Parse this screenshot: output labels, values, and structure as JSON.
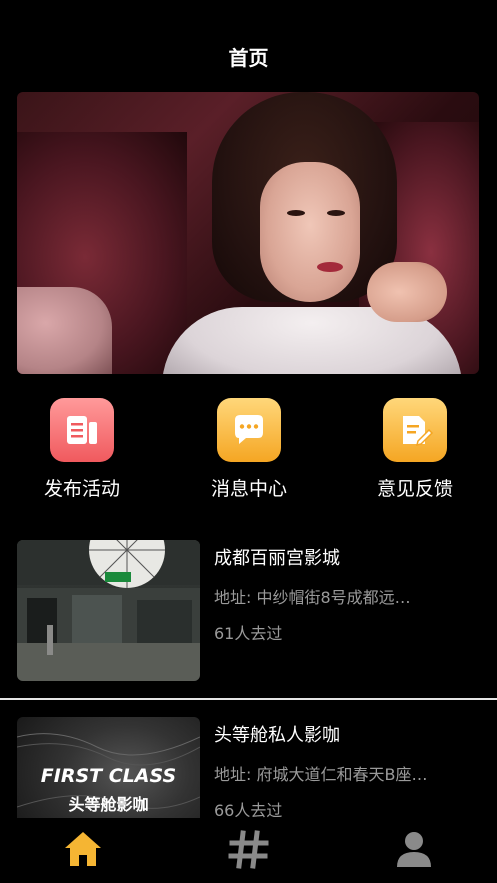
{
  "header": {
    "title": "首页"
  },
  "quick_actions": [
    {
      "label": "发布活动",
      "icon": "document-icon",
      "color": "#f05a5e"
    },
    {
      "label": "消息中心",
      "icon": "chat-bubble-icon",
      "color": "#f5a623"
    },
    {
      "label": "意见反馈",
      "icon": "edit-note-icon",
      "color": "#f5a623"
    }
  ],
  "cinemas": [
    {
      "name": "成都百丽宫影城",
      "address": "地址: 中纱帽街8号成都远…",
      "visits": "61人去过",
      "thumb_sign": "出口"
    },
    {
      "name": "头等舱私人影咖",
      "address": "地址: 府城大道仁和春天B座…",
      "visits": "66人去过",
      "thumb_text_en": "FIRST CLASS",
      "thumb_text_cn": "头等舱影咖"
    }
  ],
  "tabbar": {
    "items": [
      {
        "icon": "home-icon",
        "active": true,
        "color": "#f5b533"
      },
      {
        "icon": "hashtag-icon",
        "active": false,
        "color": "#8a8a8a"
      },
      {
        "icon": "user-icon",
        "active": false,
        "color": "#8a8a8a"
      }
    ]
  }
}
